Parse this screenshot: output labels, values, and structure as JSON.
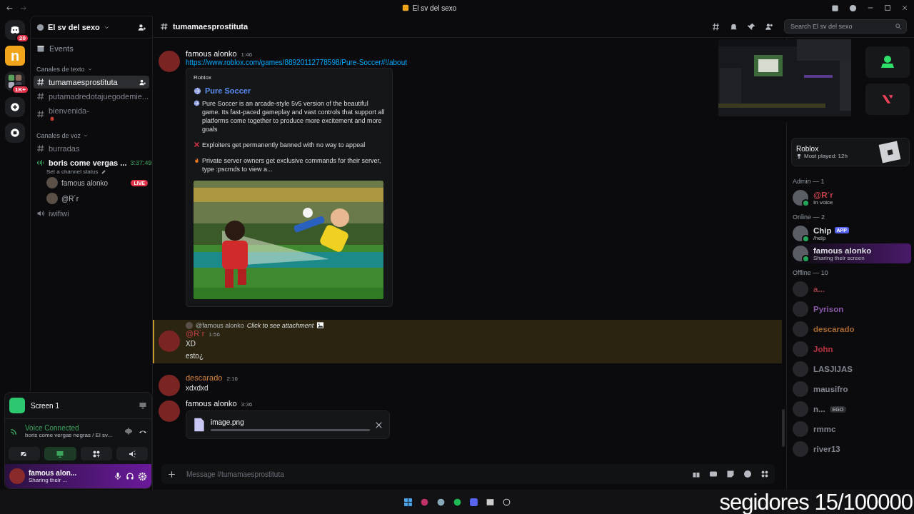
{
  "title_bar": {
    "title": "El sv del sexo"
  },
  "servers": [
    {
      "kind": "home",
      "badge": "20",
      "selected": false
    },
    {
      "kind": "n",
      "selected": true
    },
    {
      "kind": "group",
      "badge": "1K+",
      "selected": false
    },
    {
      "kind": "add",
      "selected": false
    },
    {
      "kind": "discover",
      "selected": false
    }
  ],
  "channel_sidebar": {
    "server_name": "El sv del sexo",
    "events_label": "Events",
    "categories": [
      {
        "label": "Canales de texto",
        "channels": [
          {
            "kind": "text",
            "name": "tumamaesprostituta",
            "selected": true
          },
          {
            "kind": "text",
            "name": "putamadredotajuegodemie...",
            "selected": false
          },
          {
            "kind": "text",
            "name": "bienvenida-",
            "selected": false,
            "rooster": true
          }
        ]
      },
      {
        "label": "Canales de voz",
        "channels": [
          {
            "kind": "text",
            "name": "burradas",
            "selected": false
          },
          {
            "kind": "voice",
            "name": "boris come vergas ...",
            "timer": "3:37:49",
            "status_hint": "Set a channel status",
            "active": true,
            "users": [
              {
                "name": "famous alonko",
                "live": true,
                "live_label": "LIVE"
              },
              {
                "name": "@R´r",
                "live": false
              }
            ]
          },
          {
            "kind": "voice",
            "name": "iwifiwi",
            "active": false
          }
        ]
      }
    ]
  },
  "voice_panel": {
    "screen_label": "Screen 1",
    "status": "Voice Connected",
    "channel": "boris come vergas negras / El sv...",
    "user_name": "famous alon...",
    "user_activity": "Sharing their ..."
  },
  "chat_header": {
    "channel": "tumamaesprostituta",
    "search_placeholder": "Search El sv del sexo"
  },
  "messages": [
    {
      "kind": "embed",
      "author": "famous alonko",
      "color": "#f2f3f5",
      "time": "1:46",
      "link": "https://www.roblox.com/games/88920112778598/Pure-Soccer#!/about",
      "embed": {
        "provider": "Roblox",
        "title": "Pure Soccer",
        "paragraphs": [
          {
            "kind": "globe",
            "text": "Pure Soccer is an arcade-style 5v5 version of the beautiful game. Its fast-paced gameplay and vast controls that support all platforms come together to produce more excitement and more goals"
          },
          {
            "kind": "cross",
            "text": "Exploiters get permanently banned with no way to appeal"
          },
          {
            "kind": "fire",
            "text": "Private server owners get exclusive commands for their server, type :pscmds to view a..."
          }
        ]
      }
    },
    {
      "kind": "reply",
      "highlighted": true,
      "reply_to": "@famous alonko",
      "reply_text": "Click to see attachment",
      "author": "@R´r",
      "color": "#c6424a",
      "time": "1:56",
      "lines": [
        "XD",
        "esto¿"
      ]
    },
    {
      "kind": "text",
      "highlighted": false,
      "author": "descarado",
      "color": "#d8843c",
      "time": "2:16",
      "lines": [
        "xdxdxd"
      ]
    },
    {
      "kind": "upload",
      "author": "famous alonko",
      "color": "#f2f3f5",
      "time": "3:36",
      "file": "image.png",
      "level": 1
    }
  ],
  "composer": {
    "placeholder": "Message #tumamaesprostituta"
  },
  "activity_card": {
    "game": "Roblox",
    "detail": "Most played: 12h"
  },
  "member_groups": [
    {
      "label": "Admin — 1",
      "members": [
        {
          "name": "@R´r",
          "color": "#c6424a",
          "status": "In voice",
          "offline": false
        }
      ]
    },
    {
      "label": "Online — 2",
      "members": [
        {
          "name": "Chip",
          "color": "#dbdee1",
          "status": "/help",
          "offline": false,
          "badge": "APP"
        },
        {
          "name": "famous alonko",
          "color": "#dbdee1",
          "status": "Sharing their screen",
          "offline": false,
          "streaming": true
        }
      ]
    },
    {
      "label": "Offline — 10",
      "members": [
        {
          "name": "a...",
          "color": "#9a3a42",
          "offline": true
        },
        {
          "name": "Pyrison",
          "color": "#8a5aaa",
          "offline": true
        },
        {
          "name": "descarado",
          "color": "#a8682e",
          "offline": true
        },
        {
          "name": "John",
          "color": "#b83440",
          "offline": true
        },
        {
          "name": "LASJIJAS",
          "color": "#80848e",
          "offline": true
        },
        {
          "name": "mausifro",
          "color": "#80848e",
          "offline": true
        },
        {
          "name": "n...",
          "color": "#80848e",
          "offline": true,
          "badge": "EGO"
        },
        {
          "name": "rmmc",
          "color": "#80848e",
          "offline": true
        },
        {
          "name": "river13",
          "color": "#80848e",
          "offline": true
        }
      ]
    }
  ],
  "overlay_text": "segidores 15/100000"
}
